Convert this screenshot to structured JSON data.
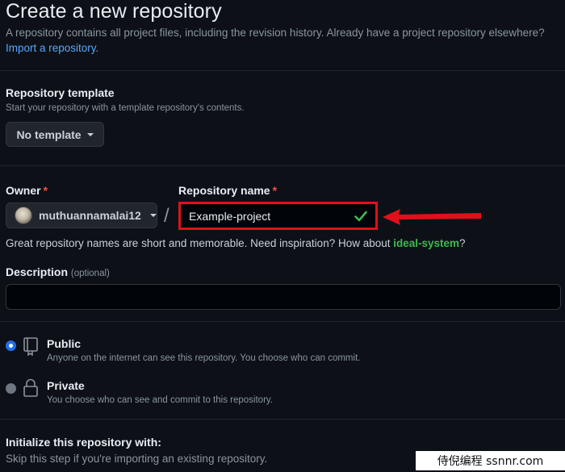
{
  "header": {
    "title": "Create a new repository",
    "subtitle": "A repository contains all project files, including the revision history. Already have a project repository elsewhere?",
    "import_link": "Import a repository."
  },
  "template": {
    "label": "Repository template",
    "sub": "Start your repository with a template repository's contents.",
    "button_label": "No template"
  },
  "owner": {
    "label": "Owner",
    "required_mark": "*",
    "value": "muthuannamalai12"
  },
  "repo_name": {
    "label": "Repository name",
    "required_mark": "*",
    "value": "Example-project",
    "separator": "/"
  },
  "hint": {
    "text": "Great repository names are short and memorable. Need inspiration? How about ",
    "suggestion": "ideal-system",
    "suffix": "?"
  },
  "description": {
    "label": "Description",
    "optional": "(optional)",
    "value": ""
  },
  "visibility": {
    "options": [
      {
        "title": "Public",
        "sub": "Anyone on the internet can see this repository. You choose who can commit.",
        "checked": true
      },
      {
        "title": "Private",
        "sub": "You choose who can see and commit to this repository.",
        "checked": false
      }
    ]
  },
  "initialize": {
    "title": "Initialize this repository with:",
    "sub": "Skip this step if you're importing an existing repository."
  },
  "watermark": "侍倪编程 ssnnr.com",
  "colors": {
    "background": "#0d1117",
    "link": "#58a6ff",
    "success": "#3fb950",
    "highlight": "#e0101a"
  }
}
